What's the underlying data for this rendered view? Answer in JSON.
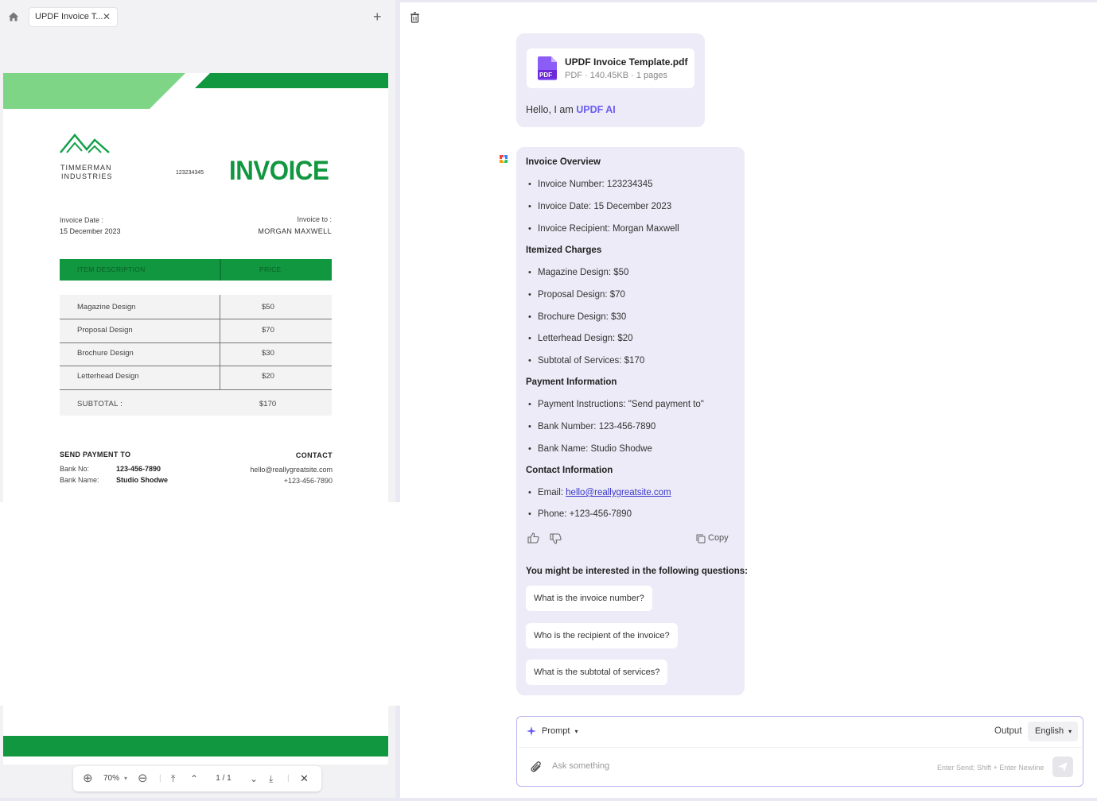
{
  "tab": {
    "title": "UPDF Invoice T..."
  },
  "invoice": {
    "company_line1": "TIMMERMAN",
    "company_line2": "INDUSTRIES",
    "number": "123234345",
    "heading": "INVOICE",
    "date_label": "Invoice Date :",
    "date_value": "15 December 2023",
    "to_label": "Invoice to :",
    "to_value": "MORGAN MAXWELL",
    "col_item": "ITEM DESCRIPTION",
    "col_price": "PRICE",
    "items": [
      {
        "name": "Magazine Design",
        "price": "$50"
      },
      {
        "name": "Proposal Design",
        "price": "$70"
      },
      {
        "name": "Brochure Design",
        "price": "$30"
      },
      {
        "name": "Letterhead Design",
        "price": "$20"
      }
    ],
    "subtotal_label": "SUBTOTAL :",
    "subtotal_value": "$170",
    "send_heading": "SEND PAYMENT TO",
    "bank_no_label": "Bank No:",
    "bank_no_value": "123-456-7890",
    "bank_name_label": "Bank Name:",
    "bank_name_value": "Studio Shodwe",
    "contact_heading": "CONTACT",
    "contact_email": "hello@reallygreatsite.com",
    "contact_phone": "+123-456-7890",
    "colors": {
      "green_dark": "#11973f",
      "green_light": "#7dd585"
    }
  },
  "viewer_toolbar": {
    "zoom": "70%",
    "page": "1",
    "sep": "/",
    "total": "1"
  },
  "chat": {
    "file_name": "UPDF Invoice Template.pdf",
    "file_meta": "PDF · 140.45KB · 1 pages",
    "file_badge": "PDF",
    "greeting_prefix": "Hello, I am ",
    "greeting_brand": "UPDF AI",
    "sections": [
      {
        "title": "Invoice Overview",
        "items": [
          "Invoice Number: 123234345",
          "Invoice Date: 15 December 2023",
          "Invoice Recipient: Morgan Maxwell"
        ]
      },
      {
        "title": "Itemized Charges",
        "items": [
          "Magazine Design: $50",
          "Proposal Design: $70",
          "Brochure Design: $30",
          "Letterhead Design: $20",
          "Subtotal of Services: $170"
        ]
      },
      {
        "title": "Payment Information",
        "items": [
          "Payment Instructions: \"Send payment to\"",
          "Bank Number: 123-456-7890",
          "Bank Name: Studio Shodwe"
        ]
      },
      {
        "title": "Contact Information",
        "items": []
      }
    ],
    "email_label": "Email: ",
    "email_value": "hello@reallygreatsite.com",
    "phone_item": "Phone: +123-456-7890",
    "copy_label": "Copy",
    "suggest_heading": "You might be interested in the following questions:",
    "suggestions": [
      "What is the invoice number?",
      "Who is the recipient of the invoice?",
      "What is the subtotal of services?"
    ],
    "brand_color": "#6b5cf0"
  },
  "composer": {
    "prompt_label": "Prompt",
    "output_label": "Output",
    "language": "English",
    "placeholder": "Ask something",
    "hint": "Enter Send; Shift + Enter Newline"
  }
}
